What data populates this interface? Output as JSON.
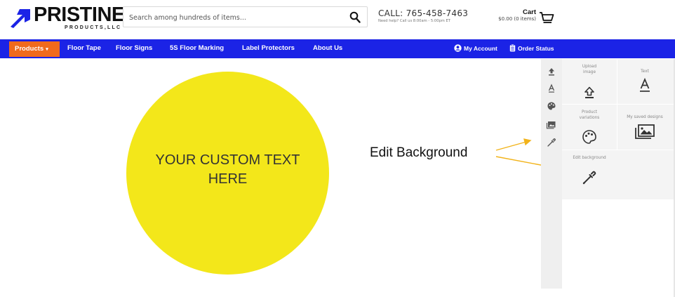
{
  "logo": {
    "wordmark": "PRISTINE",
    "sub": "PRODUCTS,LLC",
    "brand_color": "#1b23e6"
  },
  "search": {
    "placeholder": "Search among hundreds of items...",
    "icon": "search-icon"
  },
  "contact": {
    "call": "CALL: 765-458-7463",
    "help": "Need help? Call us 8:00am - 5:00pm ET"
  },
  "cart": {
    "label": "Cart",
    "amount": "$0.00 (0 items)",
    "icon": "cart-icon"
  },
  "nav": {
    "products": "Products",
    "items": [
      "Floor Tape",
      "Floor Signs",
      "5S Floor Marking",
      "Label Protectors",
      "About Us"
    ],
    "my_account": "My Account",
    "order_status": "Order Status",
    "bar_color": "#1b23e6",
    "products_color": "#f06a1c"
  },
  "canvas": {
    "text_line1": "YOUR CUSTOM TEXT",
    "text_line2": "HERE",
    "circle_color": "#f3e71a"
  },
  "annotation": {
    "label": "Edit Background",
    "arrow_color": "#f2b31a"
  },
  "tools": {
    "rail_icons": [
      "upload-icon",
      "text-icon",
      "palette-icon",
      "images-icon",
      "eyedropper-icon"
    ],
    "tiles": [
      {
        "label": "Upload image",
        "icon": "upload-icon"
      },
      {
        "label": "Text",
        "icon": "text-icon"
      },
      {
        "label": "Product variations",
        "icon": "palette-icon"
      },
      {
        "label": "My saved designs",
        "icon": "images-icon"
      },
      {
        "label": "Edit background",
        "icon": "eyedropper-icon"
      }
    ]
  }
}
